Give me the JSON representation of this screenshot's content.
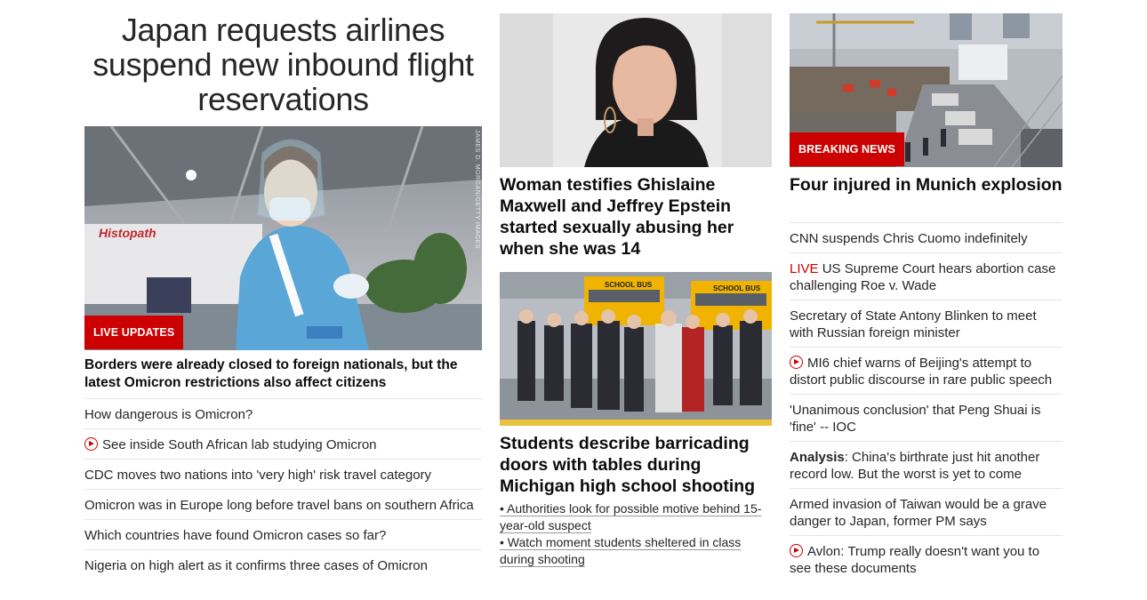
{
  "col1": {
    "headline": "Japan requests airlines suspend new inbound flight reservations",
    "photo_credit": "JAMES D. MORGAN/GETTY IMAGES",
    "photo_sign": "Histopath",
    "badge": "LIVE UPDATES",
    "subhead": "Borders were already closed to foreign nationals, but the latest Omicron restrictions also affect citizens",
    "items": [
      {
        "text": "How dangerous is Omicron?",
        "video": false
      },
      {
        "text": "See inside South African lab studying Omicron",
        "video": true
      },
      {
        "text": "CDC moves two nations into 'very high' risk travel category",
        "video": false
      },
      {
        "text": "Omicron was in Europe long before travel bans on southern Africa",
        "video": false
      },
      {
        "text": "Which countries have found Omicron cases so far?",
        "video": false
      },
      {
        "text": "Nigeria on high alert as it confirms three cases of Omicron",
        "video": false
      }
    ]
  },
  "col2": {
    "story1_headline": "Woman testifies Ghislaine Maxwell and Jeffrey Epstein started sexually abusing her when she was 14",
    "bus_label_1": "SCHOOL BUS",
    "bus_label_2": "SCHOOL BUS",
    "story2_headline": "Students describe barricading doors with tables during Michigan high school shooting",
    "sub_links": [
      "• Authorities look for possible motive behind 15-year-old suspect",
      "• Watch moment students sheltered in class during shooting"
    ]
  },
  "col3": {
    "badge": "BREAKING NEWS",
    "headline": "Four injured in Munich explosion",
    "items": [
      {
        "text": "CNN suspends Chris Cuomo indefinitely"
      },
      {
        "live": "LIVE",
        "text": "US Supreme Court hears abortion case challenging Roe v. Wade"
      },
      {
        "text": "Secretary of State Antony Blinken to meet with Russian foreign minister"
      },
      {
        "text": "MI6 chief warns of Beijing's attempt to distort public discourse in rare public speech"
      },
      {
        "text": "'Unanimous conclusion' that Peng Shuai is 'fine' -- IOC"
      },
      {
        "prefix": "Analysis",
        "text": ": China's birthrate just hit another record low. But the worst is yet to come"
      },
      {
        "text": "Armed invasion of Taiwan would be a grave danger to Japan, former PM says"
      },
      {
        "text": "Avlon: Trump really doesn't want you to see these documents"
      }
    ]
  },
  "colors": {
    "accent": "#cc0000",
    "text": "#0c0c0c",
    "divider": "#e6e6e6"
  }
}
